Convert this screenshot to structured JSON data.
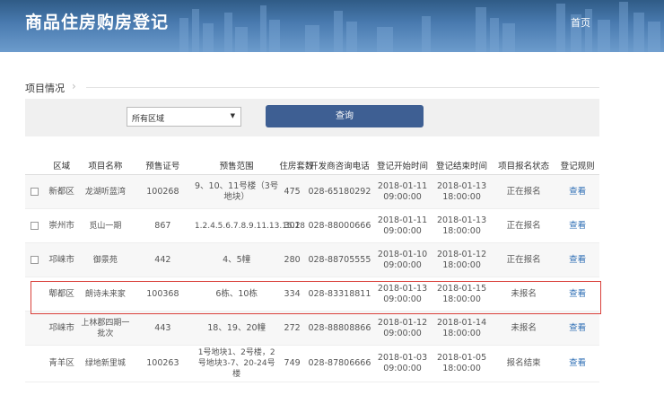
{
  "header": {
    "title": "商品住房购房登记",
    "home": "首页"
  },
  "section": {
    "title": "项目情况"
  },
  "filter": {
    "district_selected": "所有区域",
    "query_label": "查询"
  },
  "table": {
    "columns": [
      "区域",
      "项目名称",
      "预售证号",
      "预售范围",
      "住房套数",
      "开发商咨询电话",
      "登记开始时间",
      "登记结束时间",
      "项目报名状态",
      "登记规则"
    ],
    "rows": [
      {
        "district": "新都区",
        "name": "龙湖听蓝湾",
        "cert": "100268",
        "range": "9、10、11号楼（3号地块）",
        "units": "475",
        "phone": "028-65180292",
        "start": "2018-01-11 09:00:00",
        "end": "2018-01-13 18:00:00",
        "status": "正在报名",
        "rule": "查看",
        "checkbox": true
      },
      {
        "district": "崇州市",
        "name": "觅山一期",
        "cert": "867",
        "range": "1.2.4.5.6.7.8.9.11.13.15.18",
        "units": "302",
        "phone": "028-88000666",
        "start": "2018-01-11 09:00:00",
        "end": "2018-01-13 18:00:00",
        "status": "正在报名",
        "rule": "查看",
        "checkbox": true
      },
      {
        "district": "邛崃市",
        "name": "御景苑",
        "cert": "442",
        "range": "4、5幢",
        "units": "280",
        "phone": "028-88705555",
        "start": "2018-01-10 09:00:00",
        "end": "2018-01-12 18:00:00",
        "status": "正在报名",
        "rule": "查看",
        "checkbox": true
      },
      {
        "district": "郫都区",
        "name": "朗诗未来家",
        "cert": "100368",
        "range": "6栋、10栋",
        "units": "334",
        "phone": "028-83318811",
        "start": "2018-01-13 09:00:00",
        "end": "2018-01-15 18:00:00",
        "status": "未报名",
        "rule": "查看",
        "checkbox": false
      },
      {
        "district": "邛崃市",
        "name": "上林郡四期一批次",
        "cert": "443",
        "range": "18、19、20幢",
        "units": "272",
        "phone": "028-88808866",
        "start": "2018-01-12 09:00:00",
        "end": "2018-01-14 18:00:00",
        "status": "未报名",
        "rule": "查看",
        "checkbox": false
      },
      {
        "district": "青羊区",
        "name": "绿地新里城",
        "cert": "100263",
        "range": "1号地块1、2号楼，2号地块3-7、20-24号楼",
        "units": "749",
        "phone": "028-87806666",
        "start": "2018-01-03 09:00:00",
        "end": "2018-01-05 18:00:00",
        "status": "报名结束",
        "rule": "查看",
        "checkbox": false
      }
    ]
  },
  "colors": {
    "header": "#3a6a9c",
    "button": "#3e5f93",
    "link": "#2f6fb5",
    "highlight": "#d9403a"
  }
}
